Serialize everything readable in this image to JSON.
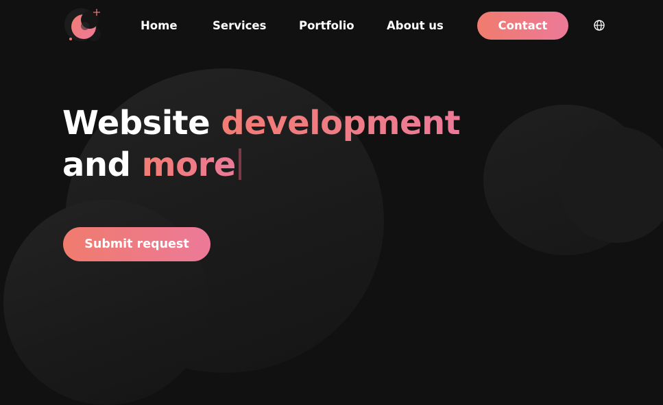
{
  "nav": {
    "items": [
      {
        "label": "Home"
      },
      {
        "label": "Services"
      },
      {
        "label": "Portfolio"
      },
      {
        "label": "About us"
      }
    ],
    "contact_label": "Contact",
    "language_icon": "globe-icon"
  },
  "hero": {
    "line1_white": "Website ",
    "line1_accent": "development",
    "line2_white": "and ",
    "line2_accent": "more",
    "submit_label": "Submit request"
  },
  "colors": {
    "background": "#111111",
    "accent_start": "#f07b6e",
    "accent_end": "#ec7a98",
    "caret": "#7a3a48",
    "text": "#ffffff"
  }
}
